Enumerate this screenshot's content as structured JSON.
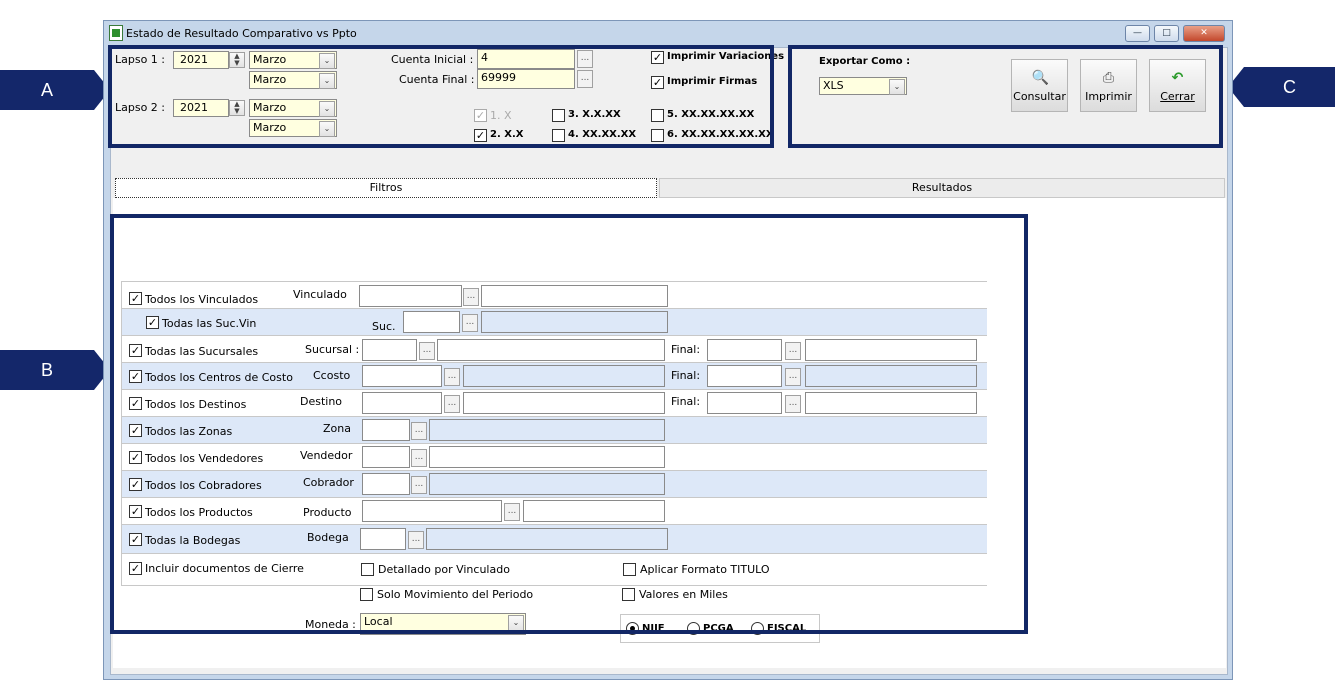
{
  "window": {
    "title": "Estado de Resultado Comparativo vs Ppto"
  },
  "callouts": {
    "a": "A",
    "b": "B",
    "c": "C"
  },
  "lapso1": {
    "label": "Lapso 1 :",
    "year": "2021",
    "month_from": "Marzo",
    "month_to": "Marzo"
  },
  "lapso2": {
    "label": "Lapso 2 :",
    "year": "2021",
    "month_from": "Marzo",
    "month_to": "Marzo"
  },
  "cuenta": {
    "inicial_label": "Cuenta Inicial :",
    "inicial_value": "4",
    "final_label": "Cuenta Final :",
    "final_value": "69999"
  },
  "print_opts": {
    "variaciones": "Imprimir Variaciones",
    "firmas": "Imprimir Firmas"
  },
  "levels": [
    "1. X",
    "2. X.X",
    "3. X.X.XX",
    "4. XX.XX.XX",
    "5. XX.XX.XX.XX",
    "6. XX.XX.XX.XX.XX"
  ],
  "export": {
    "label": "Exportar Como :",
    "value": "XLS"
  },
  "toolbar": {
    "consultar": "Consultar",
    "imprimir": "Imprimir",
    "cerrar": "Cerrar"
  },
  "tabs": {
    "filtros": "Filtros",
    "resultados": "Resultados"
  },
  "filters": {
    "vinculados": {
      "check": "Todos los Vinculados",
      "field": "Vinculado"
    },
    "sucvin": {
      "check": "Todas las Suc.Vin",
      "field": "Suc."
    },
    "sucursales": {
      "check": "Todas las Sucursales",
      "field": "Sucursal :",
      "final": "Final:"
    },
    "ccosto": {
      "check": "Todos los Centros de Costo",
      "field": "Ccosto",
      "final": "Final:"
    },
    "destinos": {
      "check": "Todos los Destinos",
      "field": "Destino",
      "final": "Final:"
    },
    "zonas": {
      "check": "Todos las Zonas",
      "field": "Zona"
    },
    "vendedores": {
      "check": "Todos los Vendedores",
      "field": "Vendedor"
    },
    "cobradores": {
      "check": "Todos los Cobradores",
      "field": "Cobrador"
    },
    "productos": {
      "check": "Todos los Productos",
      "field": "Producto"
    },
    "bodegas": {
      "check": "Todas la Bodegas",
      "field": "Bodega"
    }
  },
  "options": {
    "cierre": "Incluir documentos de Cierre",
    "detallado": "Detallado por Vinculado",
    "solo_mov": "Solo Movimiento del Periodo",
    "titulo": "Aplicar Formato TITULO",
    "miles": "Valores en Miles"
  },
  "moneda": {
    "label": "Moneda :",
    "value": "Local"
  },
  "norma": {
    "niif": "NIIF",
    "pcga": "PCGA",
    "fiscal": "FISCAL"
  }
}
